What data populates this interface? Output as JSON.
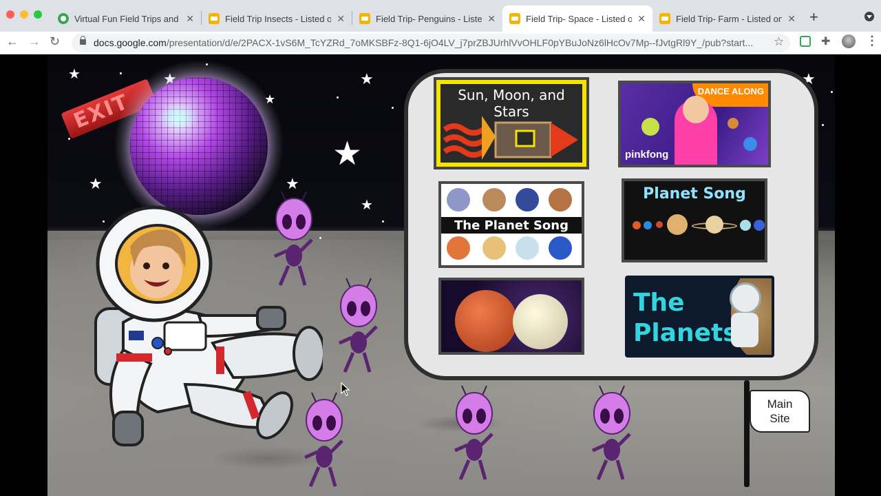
{
  "browser": {
    "tabs": [
      {
        "title": "Virtual Fun Field Trips and M",
        "active": false,
        "favicon": "green-shield-icon"
      },
      {
        "title": "Field Trip Insects - Listed or",
        "active": false,
        "favicon": "slides-icon"
      },
      {
        "title": "Field Trip- Penguins - Listec",
        "active": false,
        "favicon": "slides-icon"
      },
      {
        "title": "Field Trip- Space - Listed or",
        "active": true,
        "favicon": "slides-icon"
      },
      {
        "title": "Field Trip- Farm - Listed on",
        "active": false,
        "favicon": "slides-icon"
      }
    ],
    "url_host": "docs.google.com",
    "url_path": "/presentation/d/e/2PACX-1vS6M_TcYZRd_7oMKSBFz-8Q1-6jO4LV_j7prZBJUrhlVvOHLF0pYBuJoNz6lHcOv7Mp--fJvtgRl9Y_/pub?start..."
  },
  "slide": {
    "exit_sign": "EXIT",
    "videos": [
      {
        "title": "Sun, Moon, and Stars"
      },
      {
        "title": "DANCE ALONG",
        "brand": "pinkfong"
      },
      {
        "title": "The Planet Song"
      },
      {
        "title": "Planet Song"
      },
      {
        "title": ""
      },
      {
        "title": "The Planets"
      }
    ],
    "flag_label": "Main Site"
  },
  "colors": {
    "panel_bg": "#e6e6e6",
    "panel_border": "#2f2f2f",
    "alien": "#d47ce8"
  }
}
